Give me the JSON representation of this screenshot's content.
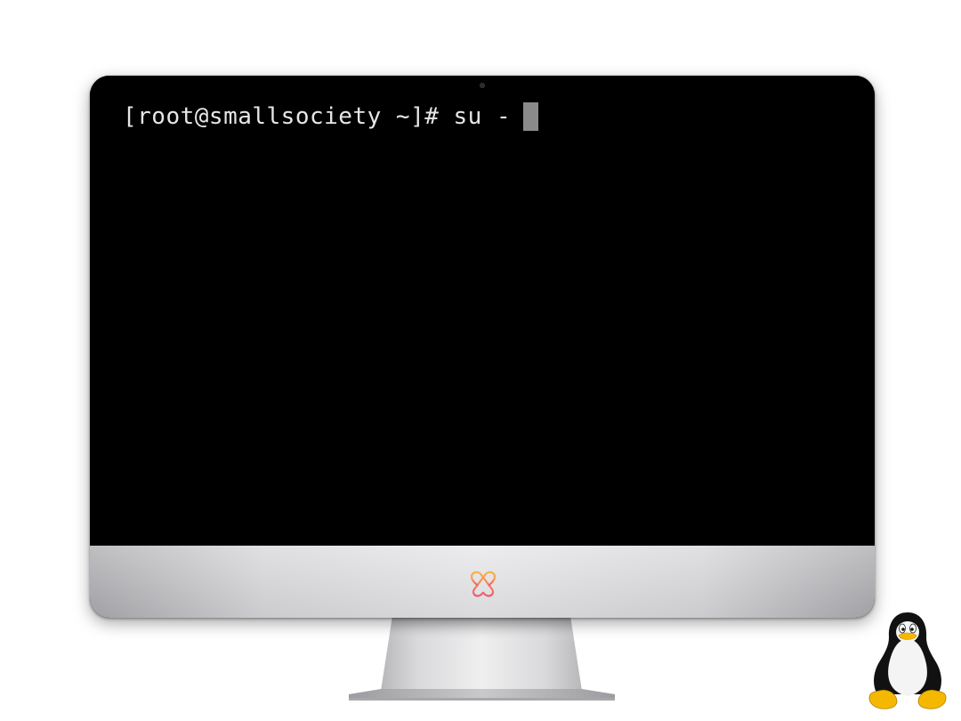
{
  "terminal": {
    "prompt": "[root@smallsociety ~]#",
    "command": "su -"
  },
  "icons": {
    "brand_logo": "interlocked-hearts-logo-icon",
    "os_mascot": "tux-penguin-icon"
  },
  "colors": {
    "screen_background": "#000000",
    "terminal_text": "#e6e6e6",
    "cursor": "#8a8a8a",
    "logo_gradient_start": "#f7b24a",
    "logo_gradient_end": "#ef5a6f",
    "penguin_beak_feet": "#f5b800"
  }
}
